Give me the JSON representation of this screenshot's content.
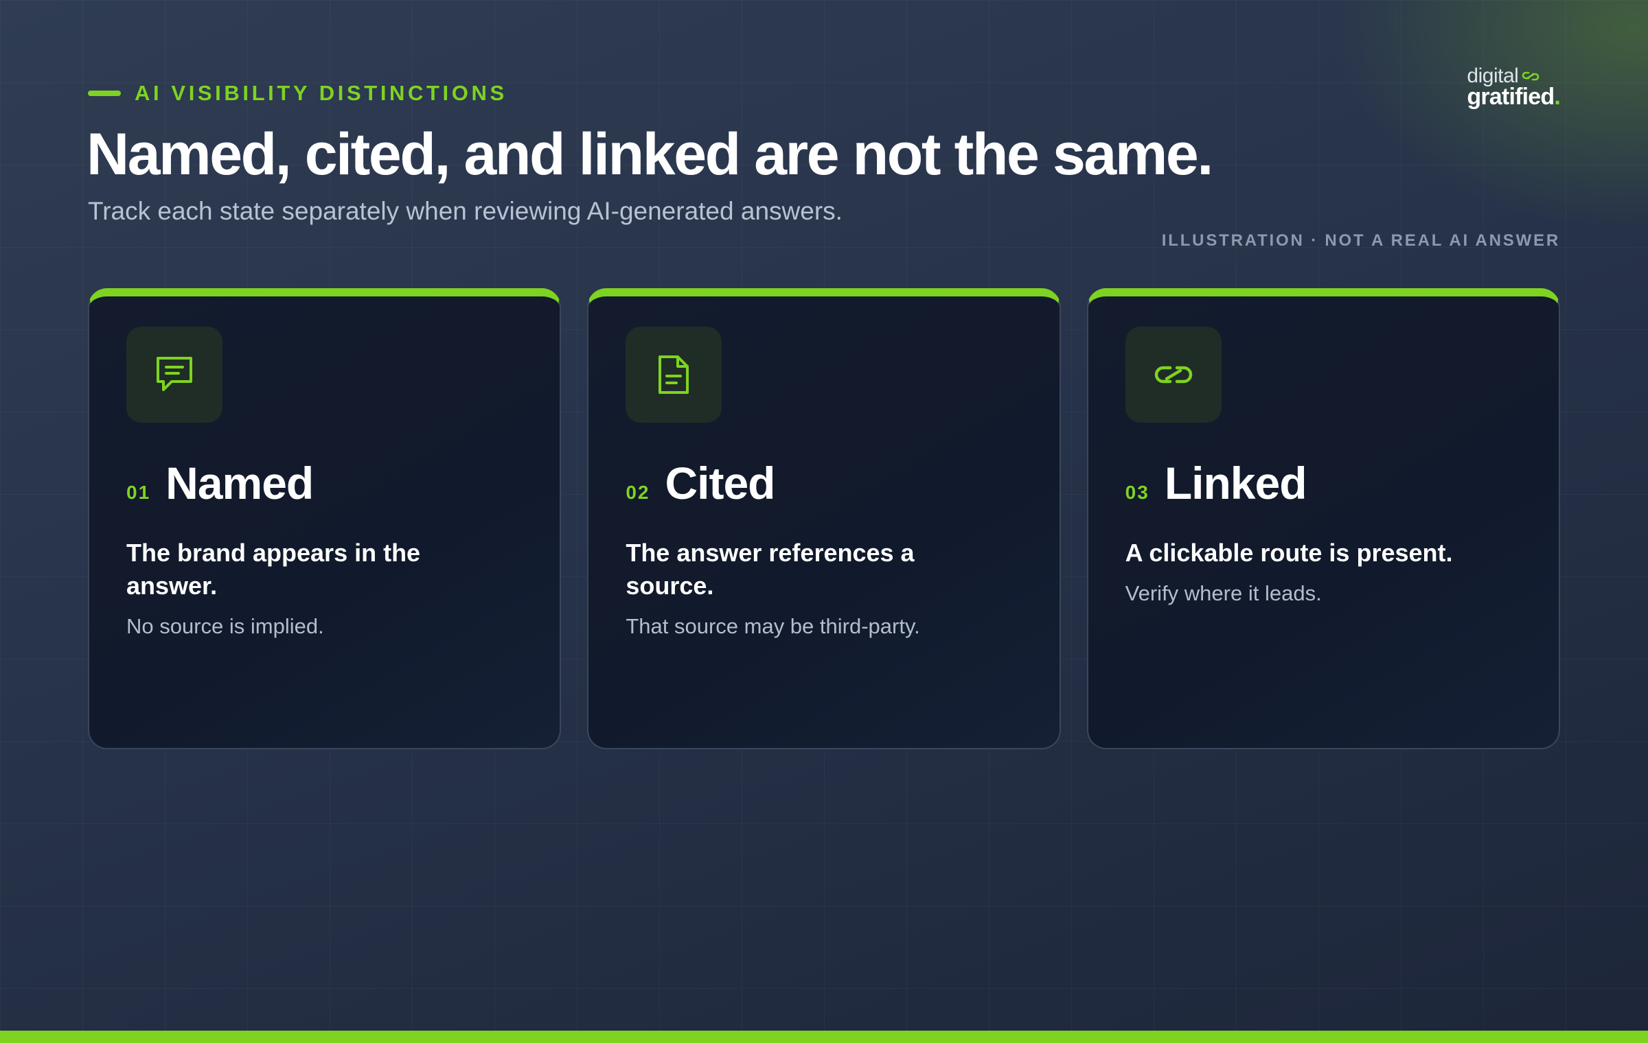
{
  "header": {
    "eyebrow": "AI VISIBILITY DISTINCTIONS",
    "title": "Named, cited, and linked are not the same.",
    "subtitle": "Track each state separately when reviewing AI-generated answers.",
    "note": "ILLUSTRATION · NOT A REAL AI ANSWER"
  },
  "logo": {
    "line1": "digital",
    "line2": "gratified",
    "dot": "."
  },
  "colors": {
    "accent": "#7ed321",
    "background": "#27334a",
    "card": "#131b2d"
  },
  "cards": [
    {
      "number": "01",
      "title": "Named",
      "lead": "The brand appears in the answer.",
      "note": "No source is implied.",
      "icon": "chat-bubble-icon"
    },
    {
      "number": "02",
      "title": "Cited",
      "lead": "The answer references a source.",
      "note": "That source may be third-party.",
      "icon": "document-icon"
    },
    {
      "number": "03",
      "title": "Linked",
      "lead": "A clickable route is present.",
      "note": "Verify where it leads.",
      "icon": "link-icon"
    }
  ]
}
